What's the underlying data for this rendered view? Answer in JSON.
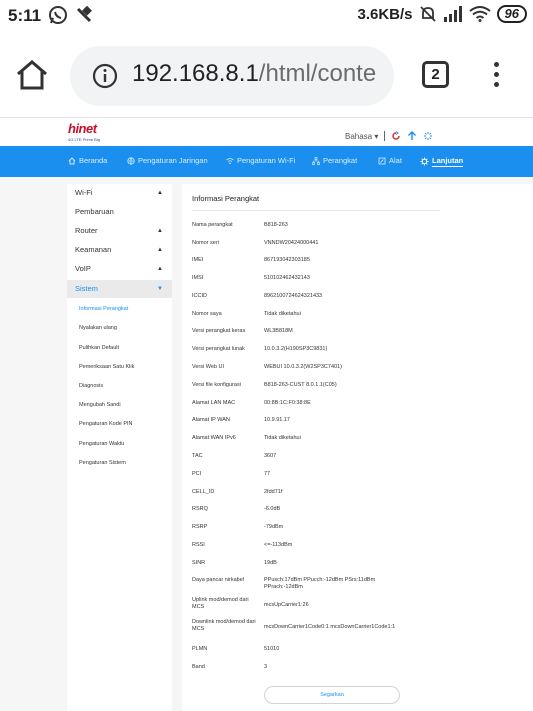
{
  "status_bar": {
    "time": "5:11",
    "net_speed": "3.6KB/s",
    "battery": "96"
  },
  "browser": {
    "url_host": "192.168.8.1",
    "url_rest": "/html/conte",
    "tab_count": "2"
  },
  "router": {
    "logo_text": "hinet",
    "logo_sub": "4G LTE Prime Big",
    "language": "Bahasa ▾",
    "nav": [
      {
        "label": "Beranda",
        "icon": "home-icon"
      },
      {
        "label": "Pengaturan Jaringan",
        "icon": "globe-icon"
      },
      {
        "label": "Pengaturan Wi-Fi",
        "icon": "wifi-icon"
      },
      {
        "label": "Perangkat",
        "icon": "devices-icon"
      },
      {
        "label": "Alat",
        "icon": "tools-icon"
      },
      {
        "label": "Lanjutan",
        "icon": "gear-icon"
      }
    ],
    "sidebar": {
      "sections": [
        {
          "label": "Wi-Fi",
          "arrow": "▲"
        },
        {
          "label": "Pembaruan",
          "arrow": ""
        },
        {
          "label": "Router",
          "arrow": "▲"
        },
        {
          "label": "Keamanan",
          "arrow": "▲"
        },
        {
          "label": "VoIP",
          "arrow": "▲"
        },
        {
          "label": "Sistem",
          "arrow": "▼"
        }
      ],
      "sub_items": [
        "Informasi Perangkat",
        "Nyalakan ulang",
        "Pulihkan Default",
        "Pemeriksaan Satu Klik",
        "Diagnosis",
        "Mengubah Sandi",
        "Pengaturan Kode PIN",
        "Pengaturan Waktu",
        "Pengaturan Sistem"
      ]
    },
    "content": {
      "title": "Informasi Perangkat",
      "rows": [
        {
          "label": "Nama perangkat",
          "value": "B818-263"
        },
        {
          "label": "Nomor seri",
          "value": "VNNDW20424000441"
        },
        {
          "label": "IMEI",
          "value": "867193042303185"
        },
        {
          "label": "IMSI",
          "value": "510102462432143"
        },
        {
          "label": "ICCID",
          "value": "8962100724624321433"
        },
        {
          "label": "Nomor saya",
          "value": "Tidak diketahui"
        },
        {
          "label": "Versi perangkat keras",
          "value": "WL3B818M"
        },
        {
          "label": "Versi perangkat lunak",
          "value": "10.0.3.2(H190SP3C9831)"
        },
        {
          "label": "Versi Web UI",
          "value": "WEBUI 10.0.3.2(W2SP3C7401)"
        },
        {
          "label": "Versi file konfigurasi",
          "value": "B818-263-CUST 8.0.1.1(C05)"
        },
        {
          "label": "Alamat LAN MAC",
          "value": "00:8B:1C:F0:38:8E"
        },
        {
          "label": "Alamat IP WAN",
          "value": "10.9.91.17"
        },
        {
          "label": "Alamat WAN IPv6",
          "value": "Tidak diketahui"
        },
        {
          "label": "TAC",
          "value": "3607"
        },
        {
          "label": "PCI",
          "value": "77"
        },
        {
          "label": "CELL_ID",
          "value": "2fdd71f"
        },
        {
          "label": "RSRQ",
          "value": "-6.0dB"
        },
        {
          "label": "RSRP",
          "value": "-79dBm"
        },
        {
          "label": "RSSI",
          "value": "<=-113dBm"
        },
        {
          "label": "SINR",
          "value": "19dB"
        },
        {
          "label": "Daya pancar nirkabel",
          "value": "PPusch:17dBm PPucch:-12dBm PSrs:11dBm PPrach:-12dBm"
        },
        {
          "label": "Uplink mod/demod dari MCS",
          "value": "mcsUpCarrier1:26"
        },
        {
          "label": "Downlink mod/demod dari MCS",
          "value": "mcsDownCarrier1Code0:1 mcsDownCarrier1Code1:1"
        },
        {
          "label": "PLMN",
          "value": "51010"
        },
        {
          "label": "Band",
          "value": "3"
        }
      ],
      "save_label": "Segarkan"
    }
  }
}
